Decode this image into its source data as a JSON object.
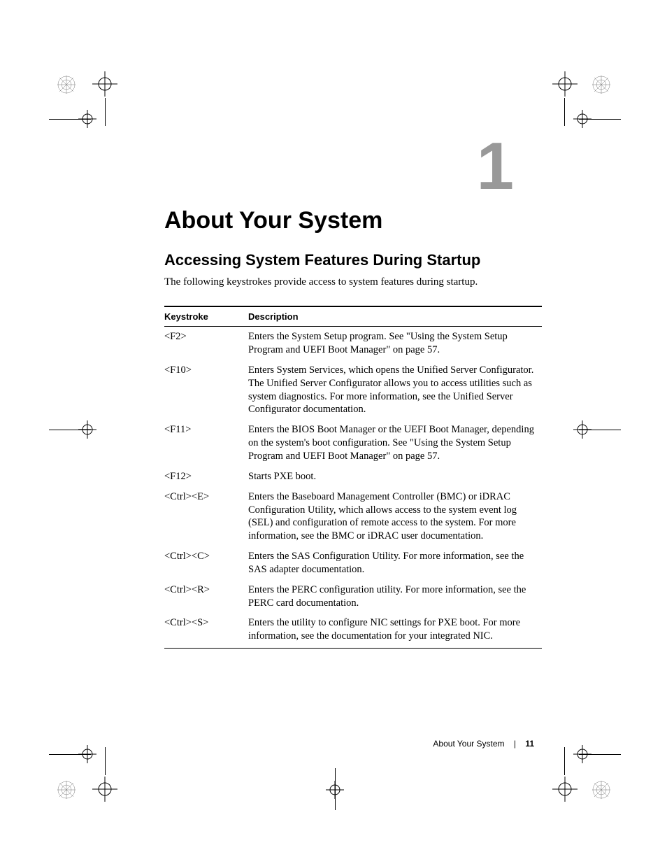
{
  "chapter_number": "1",
  "main_title": "About Your System",
  "section_title": "Accessing System Features During Startup",
  "intro_text": "The following keystrokes provide access to system features during startup.",
  "table": {
    "headers": {
      "keystroke": "Keystroke",
      "description": "Description"
    },
    "rows": [
      {
        "keystroke": "<F2>",
        "description": "Enters the System Setup program. See \"Using the System Setup Program and UEFI Boot Manager\" on page 57."
      },
      {
        "keystroke": "<F10>",
        "description": "Enters System Services, which opens the Unified Server Configurator. The Unified Server Configurator allows you to access utilities such as system diagnostics. For more information, see the Unified Server Configurator documentation."
      },
      {
        "keystroke": "<F11>",
        "description": "Enters the BIOS Boot Manager or the UEFI Boot Manager, depending on the system's boot configuration. See \"Using the System Setup Program and UEFI Boot Manager\" on page 57."
      },
      {
        "keystroke": "<F12>",
        "description": "Starts PXE boot."
      },
      {
        "keystroke": "<Ctrl><E>",
        "description": "Enters the Baseboard Management Controller (BMC) or iDRAC Configuration Utility, which allows access to the system event log (SEL) and configuration of remote access to the system. For more information, see the BMC or iDRAC user documentation."
      },
      {
        "keystroke": "<Ctrl><C>",
        "description": "Enters the SAS Configuration Utility. For more information, see the SAS adapter documentation."
      },
      {
        "keystroke": "<Ctrl><R>",
        "description": "Enters the PERC configuration utility. For more information, see the PERC card documentation."
      },
      {
        "keystroke": "<Ctrl><S>",
        "description": "Enters the utility to configure NIC settings for PXE boot. For more information, see the documentation for your integrated NIC."
      }
    ]
  },
  "footer": {
    "section_name": "About Your System",
    "page_number": "11"
  }
}
